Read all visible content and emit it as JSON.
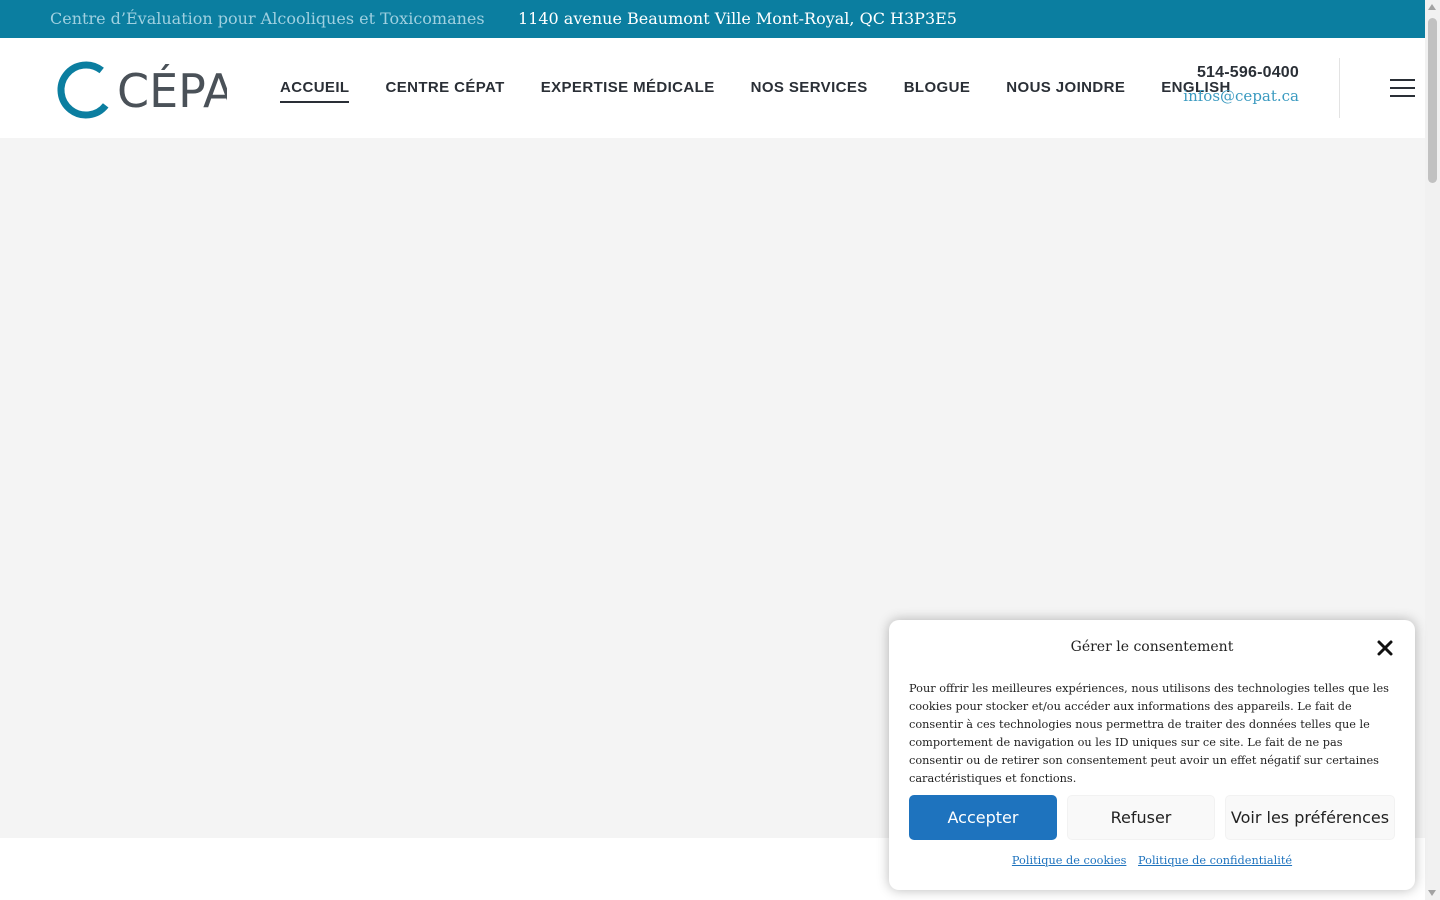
{
  "topbar": {
    "tagline": "Centre d’Évaluation pour Alcooliques et Toxicomanes",
    "address": "1140 avenue Beaumont Ville Mont-Royal, QC H3P3E5"
  },
  "logo": {
    "text": "CÉPAT"
  },
  "nav": {
    "items": [
      {
        "label": "ACCUEIL"
      },
      {
        "label": "CENTRE CÉPAT"
      },
      {
        "label": "EXPERTISE MÉDICALE"
      },
      {
        "label": "NOS SERVICES"
      },
      {
        "label": "BLOGUE"
      },
      {
        "label": "NOUS JOINDRE"
      },
      {
        "label": "ENGLISH"
      }
    ]
  },
  "contact": {
    "phone": "514-596-0400",
    "email": "infos@cepat.ca"
  },
  "cookie": {
    "title": "Gérer le consentement",
    "body": "Pour offrir les meilleures expériences, nous utilisons des technologies telles que les cookies pour stocker et/ou accéder aux informations des appareils. Le fait de consentir à ces technologies nous permettra de traiter des données telles que le comportement de navigation ou les ID uniques sur ce site. Le fait de ne pas consentir ou de retirer son consentement peut avoir un effet négatif sur certaines caractéristiques et fonctions.",
    "accept_label": "Accepter",
    "deny_label": "Refuser",
    "prefs_label": "Voir les préférences",
    "cookie_policy_label": "Politique de cookies",
    "privacy_policy_label": "Politique de confidentialité"
  },
  "colors": {
    "topbar_bg": "#0b7ea0",
    "accent_blue": "#1e73be",
    "logo_teal": "#0b7ea0",
    "logo_dark": "#4a5158",
    "hero_bg": "#f4f4f4"
  }
}
